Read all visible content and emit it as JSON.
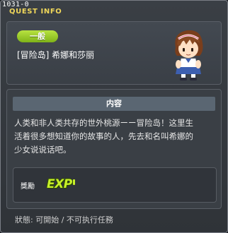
{
  "window": {
    "id": "1031-0",
    "title": "QUEST INFO"
  },
  "header": {
    "level_badge": "一般",
    "quest_name": "[冒险岛] 希娜和莎丽",
    "portrait_icon": "npc-portrait"
  },
  "content": {
    "title": "内容",
    "lines": [
      "人类和非人类共存的世外桃源ーー冒险岛！这里生",
      "活着很多想知道你的故事的人，先去和名叫希娜的",
      "少女说说话吧。"
    ]
  },
  "reward": {
    "label": "獎勵",
    "exp_label": "EXP"
  },
  "status": {
    "text": "狀態: 可開始 / 不可执行任務"
  },
  "colors": {
    "title_accent": "#f0d75a",
    "badge_green": "#8cc21e",
    "exp_green": "#c7f02a"
  }
}
